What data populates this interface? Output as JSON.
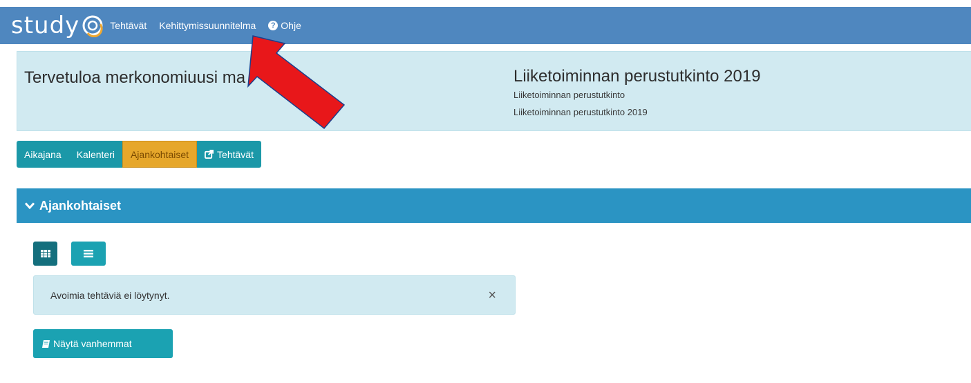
{
  "app": {
    "logo_text": "study",
    "nav": [
      {
        "label": "Tehtävät"
      },
      {
        "label": "Kehittymissuunnitelma"
      },
      {
        "label": "Ohje"
      }
    ]
  },
  "hero": {
    "welcome": "Tervetuloa merkonomiuusi ma",
    "degree_title": "Liiketoiminnan perustutkinto 2019",
    "degree_sub1": "Liiketoiminnan perustutkinto",
    "degree_sub2": "Liiketoiminnan perustutkinto 2019"
  },
  "tabs": [
    {
      "label": "Aikajana",
      "active": false
    },
    {
      "label": "Kalenteri",
      "active": false
    },
    {
      "label": "Ajankohtaiset",
      "active": true
    },
    {
      "label": "Tehtävät",
      "active": false,
      "icon": "external-link-icon"
    }
  ],
  "panel": {
    "title": "Ajankohtaiset",
    "view_options": [
      {
        "icon": "grid-view-icon",
        "selected": true
      },
      {
        "icon": "list-view-icon",
        "selected": false
      }
    ],
    "alert_text": "Avoimia tehtäviä ei löytynyt.",
    "alert_close": "×",
    "older_button": "Näytä vanhemmat"
  },
  "colors": {
    "navbar": "#4f87bf",
    "hero_bg": "#d1eaf1",
    "tab": "#1b98a8",
    "tab_active": "#e6a72b",
    "panel_header": "#2b94c3",
    "annotation_arrow": "#e8171a"
  }
}
